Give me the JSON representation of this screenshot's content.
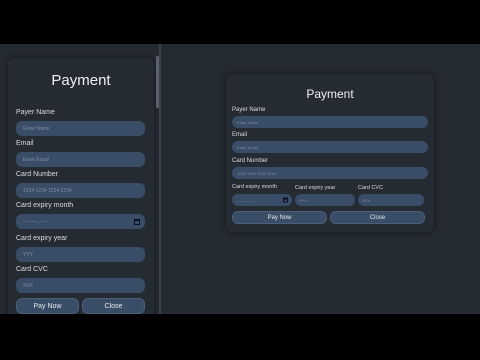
{
  "title": "Payment",
  "fields": {
    "payer_name": {
      "label": "Payer Name",
      "placeholder": "Enter Name"
    },
    "email": {
      "label": "Email",
      "placeholder": "Enter Email"
    },
    "card_number": {
      "label": "Card Number",
      "placeholder": "1234 1234 1234 1234"
    },
    "expiry_month": {
      "label": "Card expiry month",
      "placeholder": "---------, ----"
    },
    "expiry_year": {
      "label": "Card expiry year",
      "placeholder": "YYY"
    },
    "cvc": {
      "label": "Card CVC",
      "placeholder": "XXX"
    }
  },
  "buttons": {
    "pay": "Pay Now",
    "close": "Close"
  },
  "icons": {
    "calendar": "calendar-icon"
  }
}
